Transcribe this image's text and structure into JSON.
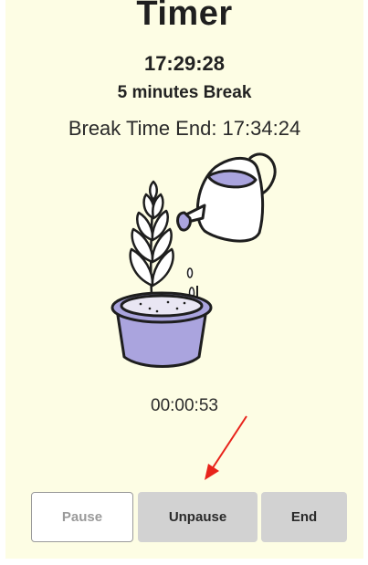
{
  "header": {
    "title": "Timer",
    "current_time": "17:29:28",
    "break_label": "5 minutes Break",
    "break_end": "Break Time End: 17:34:24"
  },
  "illustration": {
    "icon": "watering-can-plant-icon",
    "colors": {
      "pot": "#aaa4de",
      "can": "#ffffff",
      "outline": "#1e1e1e"
    }
  },
  "countdown": "00:00:53",
  "controls": {
    "pause_label": "Pause",
    "unpause_label": "Unpause",
    "end_label": "End"
  },
  "annotation": {
    "icon": "red-arrow-icon",
    "color": "#e8231b"
  }
}
